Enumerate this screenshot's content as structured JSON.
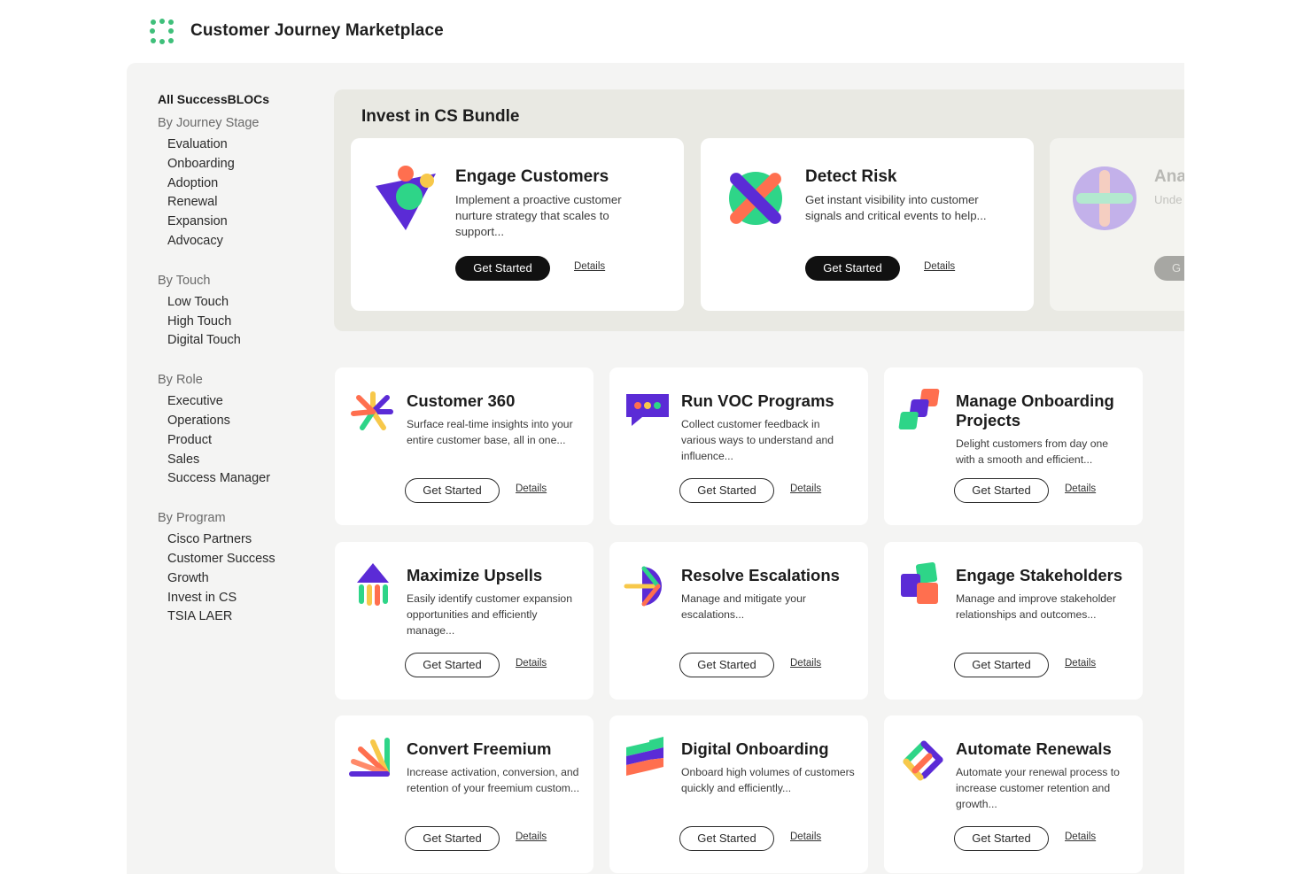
{
  "app": {
    "title": "Customer Journey Marketplace"
  },
  "sidebar": {
    "all": "All SuccessBLOCs",
    "groups": [
      {
        "label": "By Journey Stage",
        "items": [
          "Evaluation",
          "Onboarding",
          "Adoption",
          "Renewal",
          "Expansion",
          "Advocacy"
        ]
      },
      {
        "label": "By Touch",
        "items": [
          "Low Touch",
          "High Touch",
          "Digital Touch"
        ]
      },
      {
        "label": "By Role",
        "items": [
          "Executive",
          "Operations",
          "Product",
          "Sales",
          "Success Manager"
        ]
      },
      {
        "label": "By Program",
        "items": [
          "Cisco Partners",
          "Customer Success",
          "Growth",
          "Invest in CS",
          "TSIA LAER"
        ]
      }
    ]
  },
  "bundle": {
    "title": "Invest in CS Bundle",
    "cards": [
      {
        "title": "Engage Customers",
        "desc": "Implement a proactive customer nurture strategy that scales to support...",
        "cta": "Get Started",
        "details": "Details"
      },
      {
        "title": "Detect Risk",
        "desc": "Get instant visibility into customer signals and critical events to help...",
        "cta": "Get Started",
        "details": "Details"
      }
    ],
    "partial": {
      "title": "Ana",
      "desc": "Unde of yo multi",
      "cta": "G"
    },
    "next_icon": "arrow-right-icon"
  },
  "cards": [
    {
      "title": "Customer 360",
      "desc": "Surface real-time insights into your entire customer base, all in one...",
      "cta": "Get Started",
      "details": "Details"
    },
    {
      "title": "Run VOC Programs",
      "desc": "Collect customer feedback in various ways to understand and influence...",
      "cta": "Get Started",
      "details": "Details"
    },
    {
      "title": "Manage Onboarding Projects",
      "desc": "Delight customers from day one with a smooth and efficient...",
      "cta": "Get Started",
      "details": "Details"
    },
    {
      "title": "Maximize Upsells",
      "desc": "Easily identify customer expansion opportunities and efficiently manage...",
      "cta": "Get Started",
      "details": "Details"
    },
    {
      "title": "Resolve Escalations",
      "desc": "Manage and mitigate your escalations...",
      "cta": "Get Started",
      "details": "Details"
    },
    {
      "title": "Engage Stakeholders",
      "desc": "Manage and improve stakeholder relationships and outcomes...",
      "cta": "Get Started",
      "details": "Details"
    },
    {
      "title": "Convert Freemium",
      "desc": "Increase activation, conversion, and retention of your freemium custom...",
      "cta": "Get Started",
      "details": "Details"
    },
    {
      "title": "Digital Onboarding",
      "desc": "Onboard high volumes of customers quickly and efficiently...",
      "cta": "Get Started",
      "details": "Details"
    },
    {
      "title": "Automate Renewals",
      "desc": "Automate your renewal process to increase customer retention and growth...",
      "cta": "Get Started",
      "details": "Details"
    }
  ],
  "colors": {
    "purple": "#5b2bd6",
    "green": "#2ed588",
    "orange": "#ff6f4f",
    "yellow": "#f7c84a",
    "dark": "#111111"
  }
}
